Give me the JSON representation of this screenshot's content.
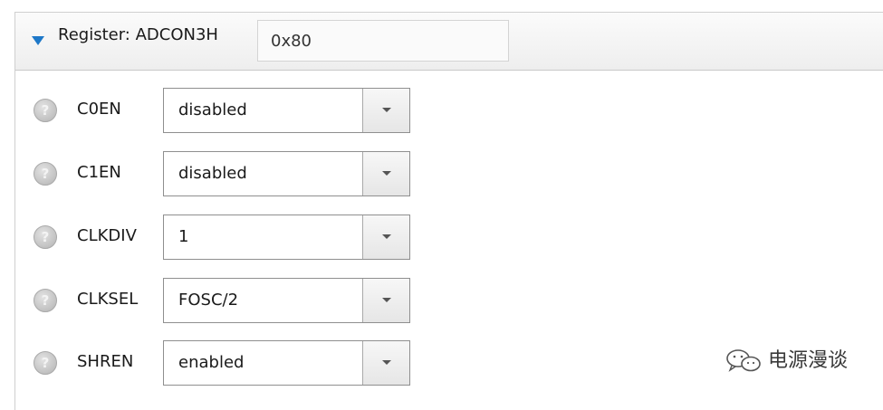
{
  "register": {
    "title": "Register: ADCON3H",
    "value": "0x80"
  },
  "rows": [
    {
      "label": "C0EN",
      "value": "disabled",
      "help_icon": "help-question-icon"
    },
    {
      "label": "C1EN",
      "value": "disabled",
      "help_icon": "help-question-icon"
    },
    {
      "label": "CLKDIV",
      "value": "1",
      "help_icon": "help-question-icon"
    },
    {
      "label": "CLKSEL",
      "value": "FOSC/2",
      "help_icon": "help-question-icon"
    },
    {
      "label": "SHREN",
      "value": "enabled",
      "help_icon": "help-question-icon"
    }
  ],
  "watermark": {
    "text": "电源漫谈",
    "icon": "wechat-icon"
  },
  "colors": {
    "expander_triangle": "#1e78c8",
    "header_bg": "#eeeeee"
  }
}
